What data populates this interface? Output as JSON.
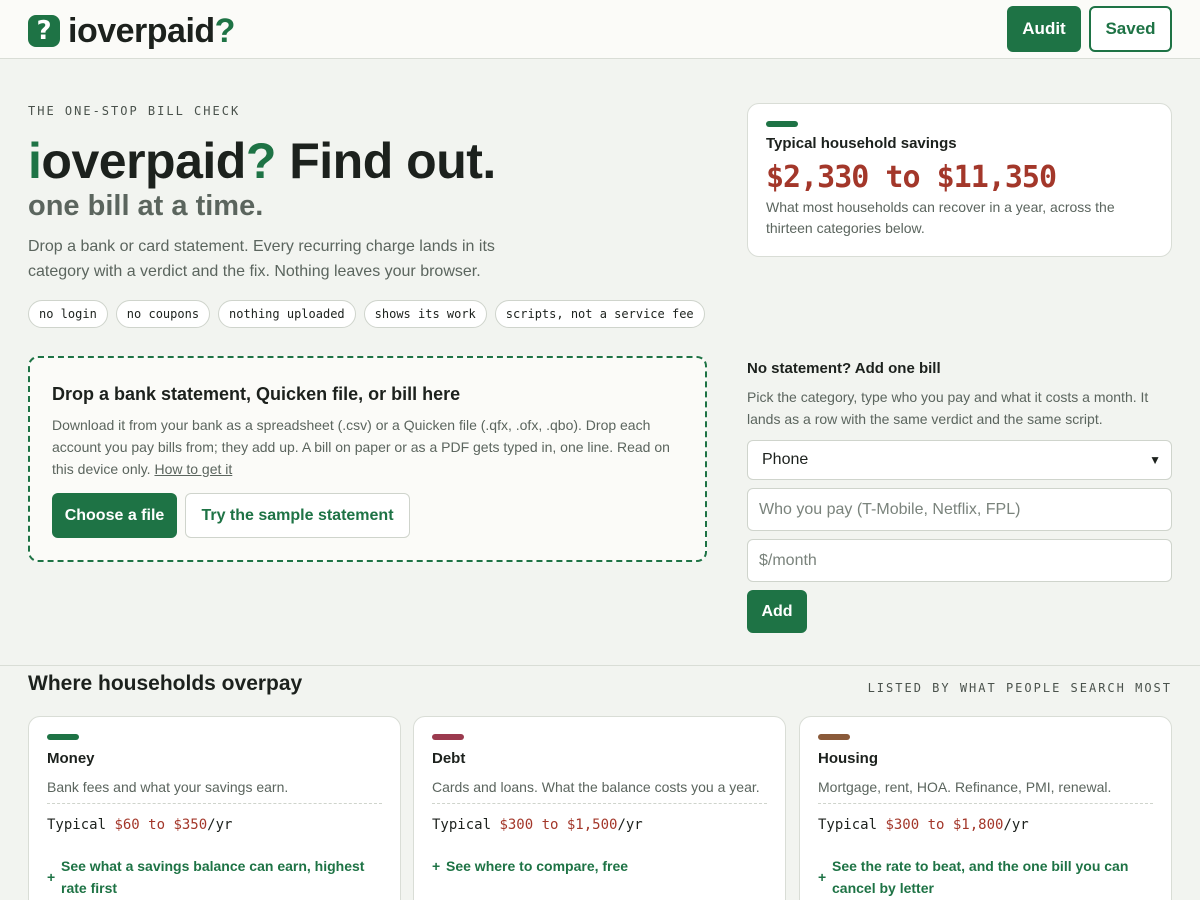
{
  "header": {
    "logo_mark": "?",
    "logo_text_main": "ioverpaid",
    "logo_text_q": "?",
    "audit_label": "Audit",
    "saved_label": "Saved"
  },
  "hero": {
    "eyebrow": "THE ONE-STOP BILL CHECK",
    "title_i": "i",
    "title_main": "overpaid",
    "title_q": "?",
    "title_rest": " Find out.",
    "subtitle": "one bill at a time.",
    "description": "Drop a bank or card statement. Every recurring charge lands in its category with a verdict and the fix. Nothing leaves your browser.",
    "chips": [
      "no login",
      "no coupons",
      "nothing uploaded",
      "shows its work",
      "scripts, not a service fee"
    ]
  },
  "savings": {
    "label": "Typical household savings",
    "range": "$2,330 to $11,350",
    "note": "What most households can recover in a year, across the thirteen categories below."
  },
  "dropzone": {
    "title": "Drop a bank statement, Quicken file, or bill here",
    "description": "Download it from your bank as a spreadsheet (.csv) or a Quicken file (.qfx, .ofx, .qbo). Drop each account you pay bills from; they add up. A bill on paper or as a PDF gets typed in, one line. Read on this device only.",
    "link": "How to get it",
    "choose_label": "Choose a file",
    "sample_label": "Try the sample statement"
  },
  "add_bill": {
    "title": "No statement? Add one bill",
    "description": "Pick the category, type who you pay and what it costs a month. It lands as a row with the same verdict and the same script.",
    "category_selected": "Phone",
    "payee_placeholder": "Who you pay (T-Mobile, Netflix, FPL)",
    "amount_placeholder": "$/month",
    "add_label": "Add"
  },
  "section": {
    "title": "Where households overpay",
    "note": "LISTED BY WHAT PEOPLE SEARCH MOST"
  },
  "categories": [
    {
      "name": "Money",
      "desc": "Bank fees and what your savings earn.",
      "typical_prefix": "Typical ",
      "typical_value": "$60 to $350",
      "typical_suffix": "/yr",
      "action": "See what a savings balance can earn, highest rate first",
      "accent": "#1e7345"
    },
    {
      "name": "Debt",
      "desc": "Cards and loans. What the balance costs you a year.",
      "typical_prefix": "Typical ",
      "typical_value": "$300 to $1,500",
      "typical_suffix": "/yr",
      "action": "See where to compare, free",
      "accent": "#9b3a4e"
    },
    {
      "name": "Housing",
      "desc": "Mortgage, rent, HOA. Refinance, PMI, renewal.",
      "typical_prefix": "Typical ",
      "typical_value": "$300 to $1,800",
      "typical_suffix": "/yr",
      "action": "See the rate to beat, and the one bill you can cancel by letter",
      "accent": "#8a5a3a"
    }
  ],
  "colors": {
    "brand_green": "#1e7345",
    "savings_red": "#a3372a"
  }
}
